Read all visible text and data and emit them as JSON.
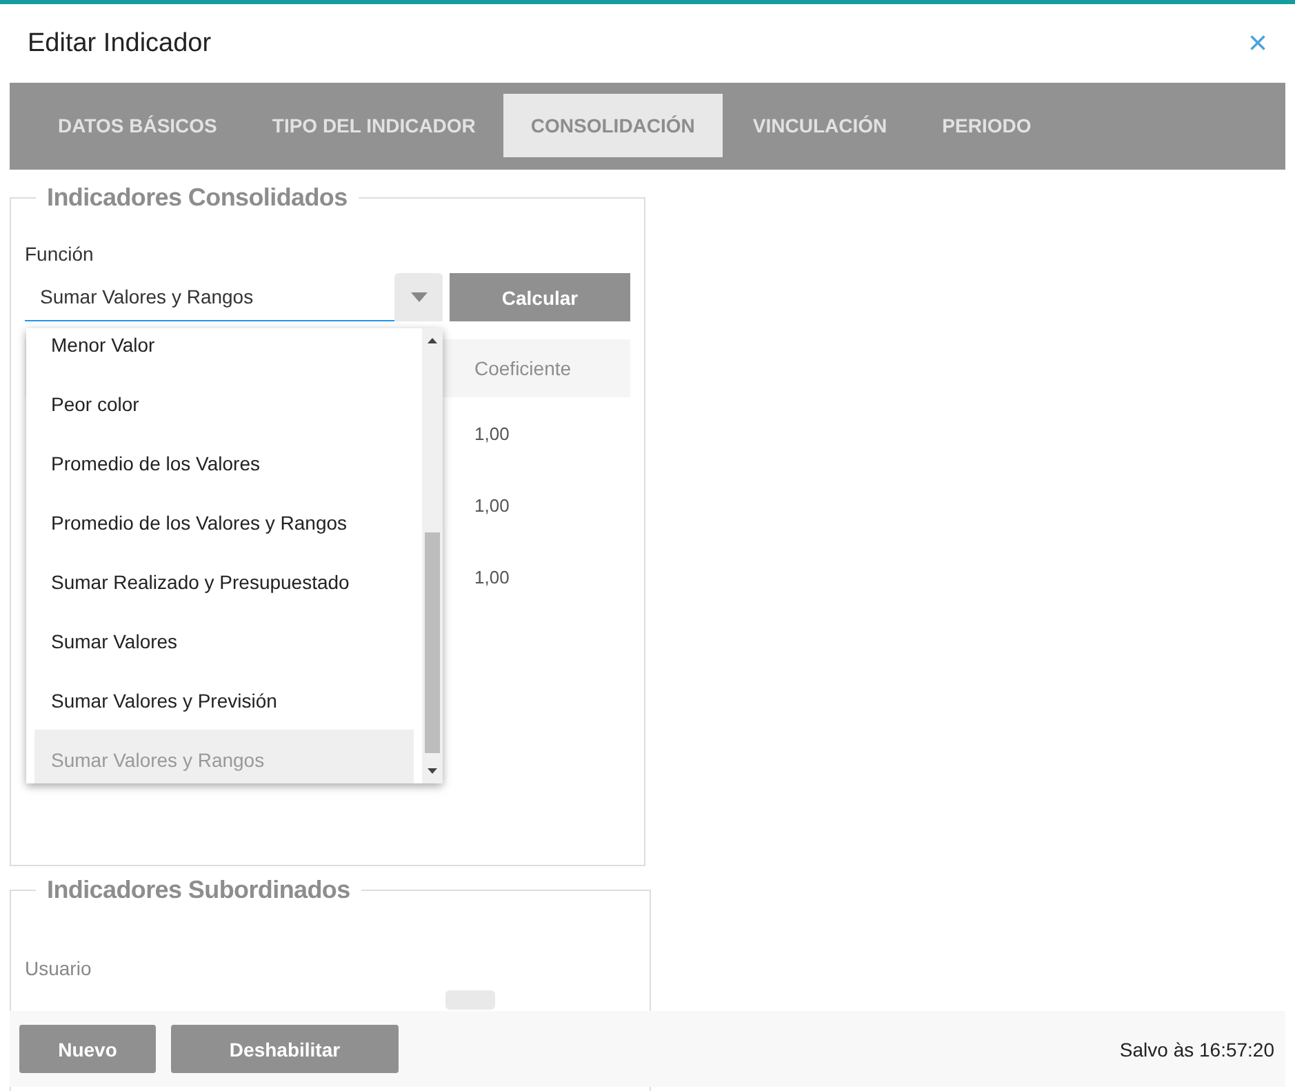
{
  "dialog": {
    "title": "Editar Indicador",
    "close": "×"
  },
  "tabs": [
    {
      "label": "DATOS BÁSICOS",
      "selected": false
    },
    {
      "label": "TIPO DEL INDICADOR",
      "selected": false
    },
    {
      "label": "CONSOLIDACIÓN",
      "selected": true
    },
    {
      "label": "VINCULACIÓN",
      "selected": false
    },
    {
      "label": "PERIODO",
      "selected": false
    }
  ],
  "consolidated": {
    "legend": "Indicadores Consolidados",
    "function_label": "Función",
    "function_value": "Sumar Valores y Rangos",
    "calculate_button": "Calcular",
    "table": {
      "columns": [
        "Coeficiente"
      ],
      "rows": [
        [
          "1,00"
        ],
        [
          "1,00"
        ],
        [
          "1,00"
        ]
      ]
    },
    "dropdown": {
      "options": [
        {
          "label": "Menor Valor",
          "selected": false
        },
        {
          "label": "Peor color",
          "selected": false
        },
        {
          "label": "Promedio de los Valores",
          "selected": false
        },
        {
          "label": "Promedio de los Valores y Rangos",
          "selected": false
        },
        {
          "label": "Sumar Realizado y Presupuestado",
          "selected": false
        },
        {
          "label": "Sumar Valores",
          "selected": false
        },
        {
          "label": "Sumar Valores y Previsión",
          "selected": false
        },
        {
          "label": "Sumar Valores y Rangos",
          "selected": true
        }
      ]
    }
  },
  "subordinates": {
    "legend": "Indicadores Subordinados",
    "user_label": "Usuario"
  },
  "footer": {
    "buttons": [
      "Nuevo",
      "Deshabilitar"
    ],
    "status": "Salvo às 16:57:20"
  }
}
